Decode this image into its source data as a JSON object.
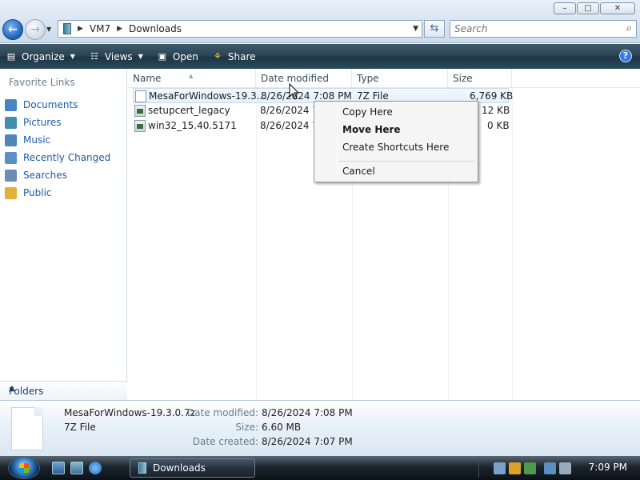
{
  "window": {
    "buttons": [
      "–",
      "□",
      "✕"
    ]
  },
  "address": {
    "segments": [
      "VM7",
      "Downloads"
    ]
  },
  "search": {
    "placeholder": "Search"
  },
  "commandbar": {
    "organize": "Organize",
    "views": "Views",
    "open": "Open",
    "share": "Share",
    "help": "?"
  },
  "sidebar": {
    "title": "Favorite Links",
    "items": [
      {
        "label": "Documents",
        "color": "#4a83c4"
      },
      {
        "label": "Pictures",
        "color": "#3f8fb0"
      },
      {
        "label": "Music",
        "color": "#4e86b8"
      },
      {
        "label": "Recently Changed",
        "color": "#5a8fc8"
      },
      {
        "label": "Searches",
        "color": "#6a8db8"
      },
      {
        "label": "Public",
        "color": "#e0b23a"
      }
    ],
    "folders_label": "Folders"
  },
  "filelist": {
    "columns": [
      "Name",
      "Date modified",
      "Type",
      "Size"
    ],
    "rows": [
      {
        "name": "MesaForWindows-19.3...",
        "date": "8/26/2024 7:08 PM",
        "type": "7Z File",
        "size": "6,769 KB"
      },
      {
        "name": "setupcert_legacy",
        "date": "8/26/2024 7:0",
        "type": "",
        "size": "12 KB"
      },
      {
        "name": "win32_15.40.5171",
        "date": "8/26/2024 7:0",
        "type": "",
        "size": "0 KB"
      }
    ]
  },
  "context_menu": {
    "items": [
      "Copy Here",
      "Move Here",
      "Create Shortcuts Here",
      "Cancel"
    ]
  },
  "details": {
    "filename": "MesaForWindows-19.3.0.7z",
    "filetype": "7Z File",
    "date_modified_label": "Date modified:",
    "date_modified": "8/26/2024 7:08 PM",
    "size_label": "Size:",
    "size": "6.60 MB",
    "date_created_label": "Date created:",
    "date_created": "8/26/2024 7:07 PM"
  },
  "taskbar": {
    "task": "Downloads",
    "clock": "7:09 PM"
  },
  "colors": {
    "accent": "#1e5aa8",
    "cmdbar": "#2a4353",
    "taskbar": "#0b1117"
  }
}
